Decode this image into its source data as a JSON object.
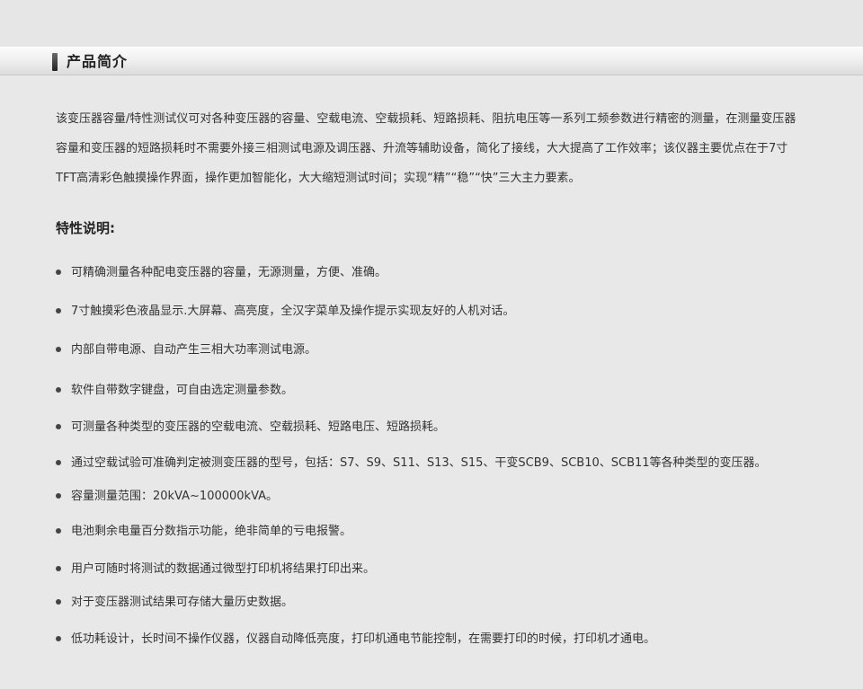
{
  "header": {
    "title": "产品简介"
  },
  "intro": {
    "text": "该变压器容量/特性测试仪可对各种变压器的容量、空载电流、空载损耗、短路损耗、阻抗电压等一系列工频参数进行精密的测量，在测量变压器容量和变压器的短路损耗时不需要外接三相测试电源及调压器、升流等辅助设备，简化了接线，大大提高了工作效率；该仪器主要优点在于7寸TFT高清彩色触摸操作界面，操作更加智能化，大大缩短测试时间；实现“精”“稳”“快”三大主力要素。"
  },
  "features": {
    "title": "特性说明:",
    "items": [
      "可精确测量各种配电变压器的容量，无源测量，方便、准确。",
      "7寸触摸彩色液晶显示.大屏幕、高亮度，全汉字菜单及操作提示实现友好的人机对话。",
      "内部自带电源、自动产生三相大功率测试电源。",
      "软件自带数字键盘，可自由选定测量参数。",
      "可测量各种类型的变压器的空载电流、空载损耗、短路电压、短路损耗。",
      "通过空载试验可准确判定被测变压器的型号，包括：S7、S9、S11、S13、S15、干变SCB9、SCB10、SCB11等各种类型的变压器。",
      "容量测量范围：20kVA~100000kVA。",
      "电池剩余电量百分数指示功能，绝非简单的亏电报警。",
      "用户可随时将测试的数据通过微型打印机将结果打印出来。",
      "对于变压器测试结果可存储大量历史数据。",
      "低功耗设计，长时间不操作仪器，仪器自动降低亮度，打印机通电节能控制，在需要打印的时候，打印机才通电。"
    ]
  }
}
